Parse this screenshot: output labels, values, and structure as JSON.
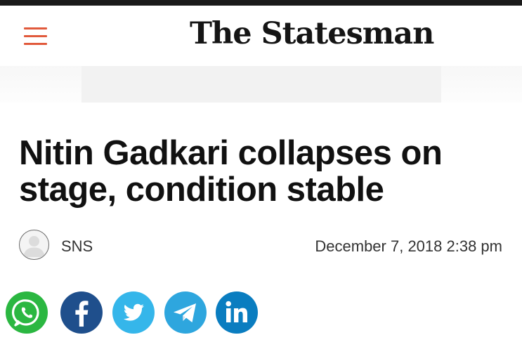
{
  "header": {
    "logo_text": "The Statesman",
    "menu_icon": "hamburger-menu-icon",
    "accent_color": "#e15a3c"
  },
  "article": {
    "headline": "Nitin Gadkari collapses on stage, condition stable",
    "author": "SNS",
    "date": "December 7, 2018 2:38 pm",
    "avatar_icon": "default-avatar-icon"
  },
  "share": {
    "buttons": [
      {
        "name": "whatsapp",
        "icon": "whatsapp-icon",
        "color": "#2bb741"
      },
      {
        "name": "facebook",
        "icon": "facebook-icon",
        "color": "#1f4f8c"
      },
      {
        "name": "twitter",
        "icon": "twitter-icon",
        "color": "#35b6ea"
      },
      {
        "name": "telegram",
        "icon": "telegram-icon",
        "color": "#2ea6de"
      },
      {
        "name": "linkedin",
        "icon": "linkedin-icon",
        "color": "#0a7dc0"
      }
    ]
  }
}
